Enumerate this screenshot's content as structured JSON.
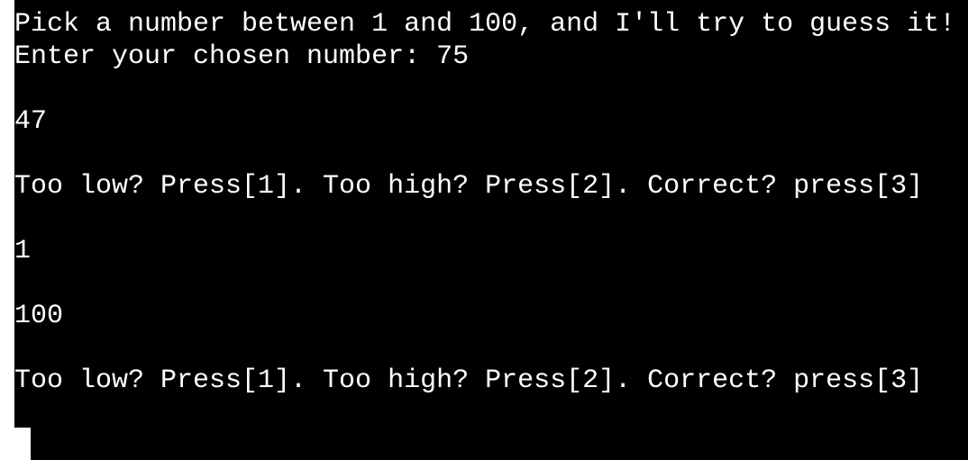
{
  "terminal": {
    "lines": [
      "Pick a number between 1 and 100, and I'll try to guess it!",
      "Enter your chosen number: 75",
      "",
      "47",
      "",
      "Too low? Press[1]. Too high? Press[2]. Correct? press[3]",
      "",
      "1",
      "",
      "100",
      "",
      "Too low? Press[1]. Too high? Press[2]. Correct? press[3]"
    ]
  },
  "colors": {
    "background": "#000000",
    "text": "#ffffff",
    "cursor": "#ffffff"
  }
}
